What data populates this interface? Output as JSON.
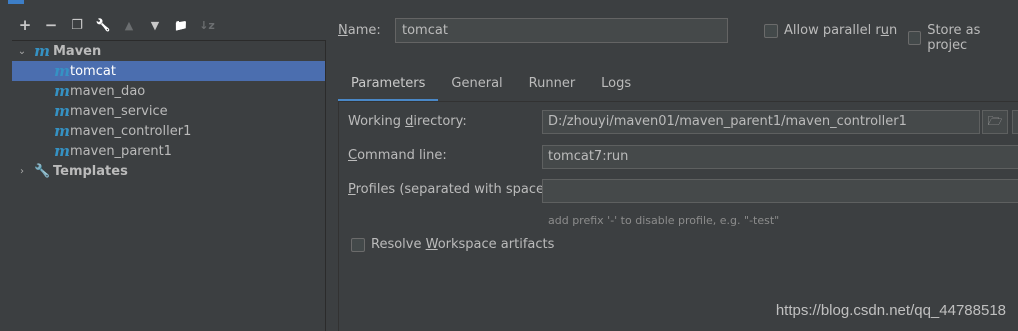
{
  "toolbar": {
    "buttons": [
      {
        "icon": "plus-icon",
        "glyph": "+",
        "enabled": true
      },
      {
        "icon": "minus-icon",
        "glyph": "−",
        "enabled": true
      },
      {
        "icon": "copy-icon",
        "glyph": "❐",
        "enabled": true
      },
      {
        "icon": "wrench-icon",
        "glyph": "🔧",
        "enabled": true
      },
      {
        "icon": "move-up-icon",
        "glyph": "▲",
        "enabled": false
      },
      {
        "icon": "move-down-icon",
        "glyph": "▼",
        "enabled": true
      },
      {
        "icon": "folder-add-icon",
        "glyph": "📁",
        "enabled": true
      },
      {
        "icon": "sort-icon",
        "glyph": "↓z",
        "enabled": false
      }
    ]
  },
  "tree": {
    "maven": {
      "label": "Maven"
    },
    "items": [
      {
        "label": "tomcat",
        "selected": true
      },
      {
        "label": "maven_dao",
        "selected": false
      },
      {
        "label": "maven_service",
        "selected": false
      },
      {
        "label": "maven_controller1",
        "selected": false
      },
      {
        "label": "maven_parent1",
        "selected": false
      }
    ],
    "templates": {
      "label": "Templates"
    }
  },
  "config": {
    "name_label_first": "N",
    "name_label_rest": "ame:",
    "name_value": "tomcat",
    "allow_parallel_label": "Allow parallel r",
    "allow_parallel_u": "u",
    "allow_parallel_end": "n",
    "store_as_project_label": "Store as projec"
  },
  "tabs": [
    {
      "label": "Parameters",
      "active": true
    },
    {
      "label": "General",
      "active": false
    },
    {
      "label": "Runner",
      "active": false
    },
    {
      "label": "Logs",
      "active": false
    }
  ],
  "parameters": {
    "working_dir_label_pre": "Working ",
    "working_dir_label_u": "d",
    "working_dir_label_post": "irectory:",
    "working_dir_value": "D:/zhouyi/maven01/maven_parent1/maven_controller1",
    "command_line_label_u": "C",
    "command_line_label_post": "ommand line:",
    "command_line_value": "tomcat7:run",
    "profiles_label_u": "P",
    "profiles_label_post": "rofiles (separated with space):",
    "profiles_value": "",
    "profiles_hint": "add prefix '-' to disable profile, e.g. \"-test\"",
    "resolve_label_pre": "Resolve ",
    "resolve_label_u": "W",
    "resolve_label_post": "orkspace artifacts"
  },
  "watermark": "https://blog.csdn.net/qq_44788518"
}
